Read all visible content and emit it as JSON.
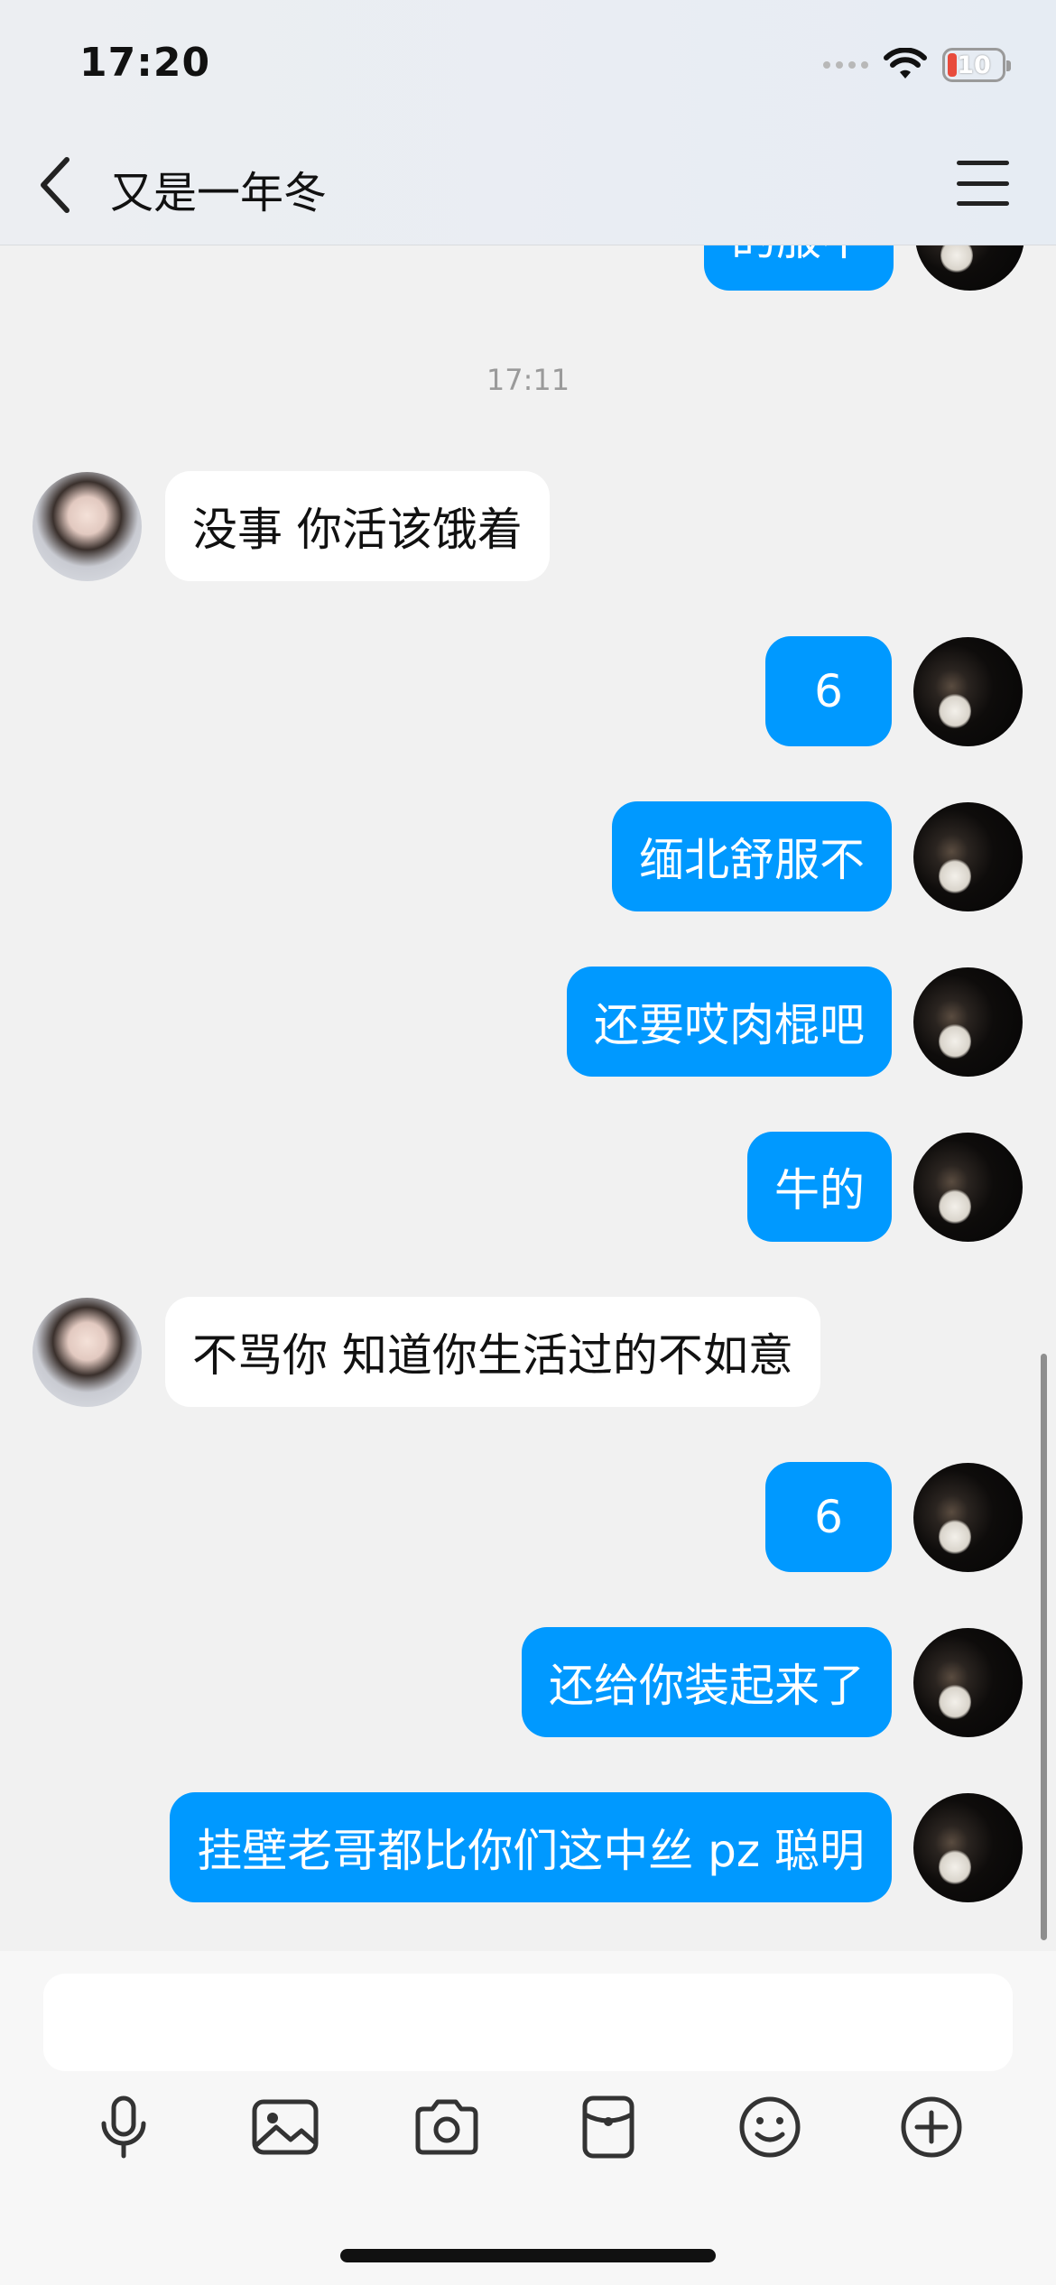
{
  "status_bar": {
    "time": "17:20",
    "battery": "10",
    "battery_color": "#e84b3c"
  },
  "header": {
    "title": "又是一年冬",
    "back_icon": "chevron-left-icon",
    "menu_icon": "hamburger-menu-icon"
  },
  "messages": {
    "partial_top": "的服不",
    "timestamp": "17:11",
    "items": [
      {
        "side": "in",
        "text": "没事 你活该饿着"
      },
      {
        "side": "out",
        "text": "6"
      },
      {
        "side": "out",
        "text": "缅北舒服不"
      },
      {
        "side": "out",
        "text": "还要哎肉棍吧"
      },
      {
        "side": "out",
        "text": "牛的"
      },
      {
        "side": "in",
        "text": "不骂你 知道你生活过的不如意"
      },
      {
        "side": "out",
        "text": "6"
      },
      {
        "side": "out",
        "text": "还给你装起来了"
      },
      {
        "side": "out",
        "text": "挂壁老哥都比你们这中丝 pz 聪明"
      }
    ]
  },
  "input": {
    "value": ""
  },
  "toolbar": {
    "icons": [
      "microphone-icon",
      "image-icon",
      "camera-icon",
      "red-packet-icon",
      "emoji-icon",
      "plus-icon"
    ]
  },
  "colors": {
    "outgoing_bubble": "#0099ff",
    "incoming_bubble": "#ffffff",
    "background": "#f1f1f1"
  }
}
